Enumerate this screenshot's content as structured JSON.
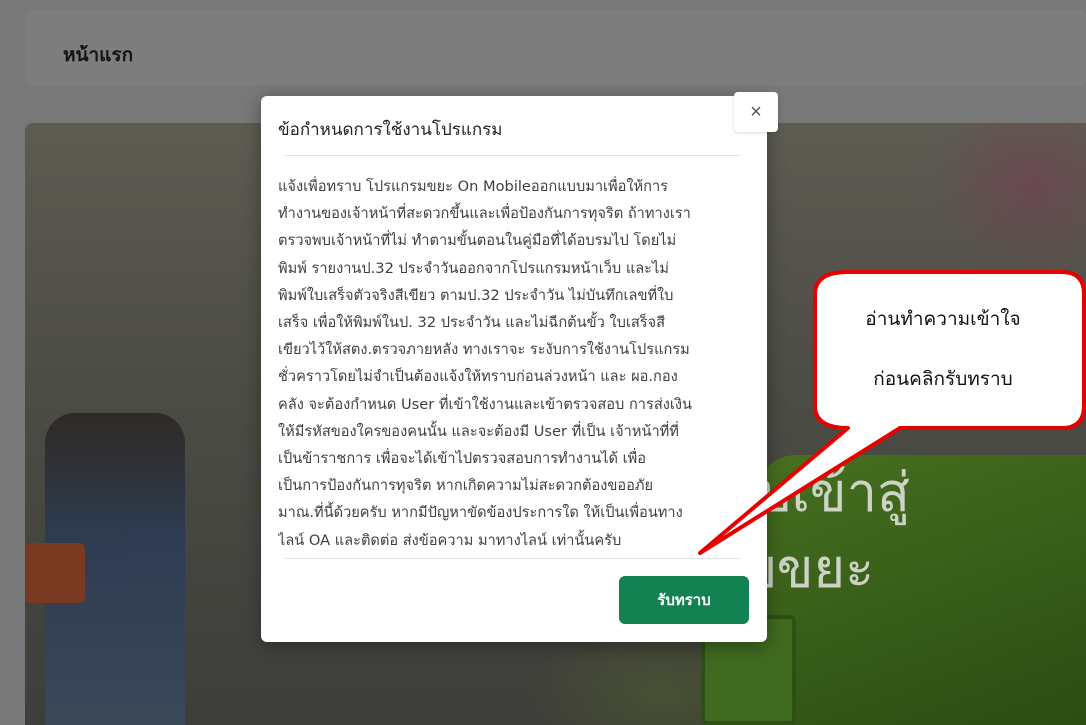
{
  "page": {
    "header_title": "หน้าแรก",
    "banner_text_line1": "ยินดีต้อนรับเข้าสู่",
    "banner_text_line2": "ระบบขยะ"
  },
  "modal": {
    "title": "ข้อกำหนดการใช้งานโปรแกรม",
    "close_symbol": "×",
    "body_lines": [
      "แจ้งเพื่อทราบ โปรแกรมขยะ On Mobileออกแบบมาเพื่อให้การ",
      "ทำงานของเจ้าหน้าที่สะดวกขึ้นและเพื่อป้องกันการทุจริต ถ้าทางเรา",
      "ตรวจพบเจ้าหน้าที่ไม่ ทำตามขั้นตอนในคู่มือที่ได้อบรมไป โดยไม่",
      "พิมพ์ รายงานป.32 ประจำวันออกจากโปรแกรมหน้าเว็บ และไม่",
      "พิมพ์ใบเสร็จตัวจริงสีเขียว ตามป.32 ประจำวัน ไม่บันทึกเลขที่ใบ",
      "เสร็จ เพื่อให้พิมพ์ในป. 32 ประจำวัน และไม่ฉีกต้นขั้ว ใบเสร็จสี",
      "เขียวไว้ให้สตง.ตรวจภายหลัง ทางเราจะ ระงับการใช้งานโปรแกรม",
      "ชั่วคราวโดยไม่จำเป็นต้องแจ้งให้ทราบก่อนล่วงหน้า และ ผอ.กอง",
      "คลัง จะต้องกำหนด User ที่เข้าใช้งานและเข้าตรวจสอบ การส่งเงิน",
      "ให้มีรหัสของใครของคนนั้น และจะต้องมี User ที่เป็น เจ้าหน้าที่ที่",
      "เป็นข้าราชการ เพื่อจะได้เข้าไปตรวจสอบการทำงานได้ เพื่อ",
      "เป็นการป้องกันการทุจริต หากเกิดความไม่สะดวกต้องขออภัย",
      "มาณ.ที่นี้ด้วยครับ หากมีปัญหาขัดข้องประการใด ให้เป็นเพื่อนทาง",
      "ไลน์ OA และติดต่อ ส่งข้อความ มาทางไลน์ เท่านั้นครับ"
    ],
    "ok_label": "รับทราบ"
  },
  "callout": {
    "line1": "อ่านทำความเข้าใจ",
    "line2": "ก่อนคลิกรับทราบ",
    "border_color": "#e60000",
    "fill_color": "#ffffff"
  },
  "colors": {
    "ok_button": "#128253",
    "backdrop": "#787878"
  }
}
